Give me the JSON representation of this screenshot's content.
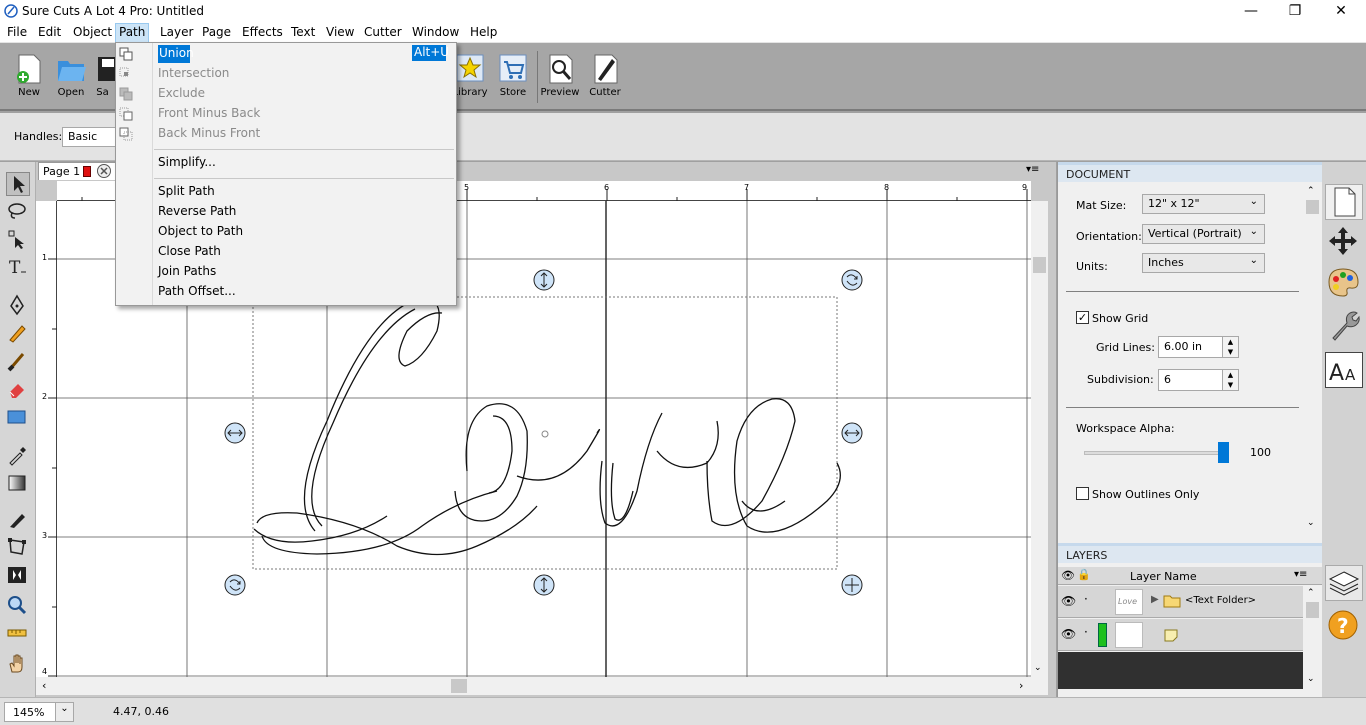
{
  "app": {
    "title": "Sure Cuts A Lot 4 Pro: Untitled"
  },
  "menu": [
    "File",
    "Edit",
    "Object",
    "Path",
    "Layer",
    "Page",
    "Effects",
    "Text",
    "View",
    "Cutter",
    "Window",
    "Help"
  ],
  "toolbar": {
    "new": "New",
    "open": "Open",
    "save": "Sa",
    "library": "Library",
    "store": "Store",
    "preview": "Preview",
    "cutter": "Cutter"
  },
  "handles": {
    "label": "Handles:",
    "value": "Basic"
  },
  "page_tab": "Page 1",
  "ruler": {
    "h": [
      "5",
      "6",
      "7",
      "8",
      "9"
    ],
    "v": [
      "1",
      "2",
      "3",
      "4"
    ]
  },
  "path_menu": {
    "items": [
      {
        "label": "Union",
        "shortcut": "Alt+U",
        "enabled": true
      },
      {
        "label": "Intersection",
        "enabled": false
      },
      {
        "label": "Exclude",
        "enabled": false
      },
      {
        "label": "Front Minus Back",
        "enabled": false
      },
      {
        "label": "Back Minus Front",
        "enabled": false
      },
      {
        "label": "Simplify...",
        "enabled": true
      },
      {
        "label": "Split Path",
        "enabled": true
      },
      {
        "label": "Reverse Path",
        "enabled": true
      },
      {
        "label": "Object to Path",
        "enabled": true
      },
      {
        "label": "Close Path",
        "enabled": true
      },
      {
        "label": "Join Paths",
        "enabled": true
      },
      {
        "label": "Path Offset...",
        "enabled": true
      }
    ]
  },
  "canvas": {
    "text": "Love"
  },
  "document": {
    "header": "DOCUMENT",
    "mat_size_label": "Mat Size:",
    "mat_size": "12\" x 12\"",
    "orientation_label": "Orientation:",
    "orientation": "Vertical (Portrait)",
    "units_label": "Units:",
    "units": "Inches",
    "show_grid": "Show Grid",
    "show_grid_checked": true,
    "grid_lines_label": "Grid Lines:",
    "grid_lines": "6.00 in",
    "subdivision_label": "Subdivision:",
    "subdivision": "6",
    "workspace_alpha_label": "Workspace Alpha:",
    "workspace_alpha": "100",
    "show_outlines": "Show Outlines Only",
    "show_outlines_checked": false
  },
  "layers": {
    "header": "LAYERS",
    "col": "Layer Name",
    "rows": [
      {
        "name": "<Text Folder>"
      },
      {
        "name": ""
      }
    ]
  },
  "status": {
    "zoom": "145%",
    "coords": "4.47, 0.46"
  },
  "colors": {
    "accent": "#0078d7",
    "layer_green": "#1ec01e",
    "page_red": "#e01010"
  }
}
